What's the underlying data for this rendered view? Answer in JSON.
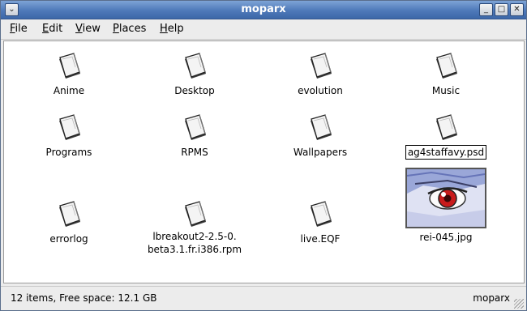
{
  "window": {
    "title": "moparx"
  },
  "menu": [
    {
      "label": "File",
      "u": "F",
      "rest": "ile"
    },
    {
      "label": "Edit",
      "u": "E",
      "rest": "dit"
    },
    {
      "label": "View",
      "u": "V",
      "rest": "iew"
    },
    {
      "label": "Places",
      "u": "P",
      "rest": "laces"
    },
    {
      "label": "Help",
      "u": "H",
      "rest": "elp"
    }
  ],
  "files": [
    {
      "name": "Anime",
      "icon": "document-icon"
    },
    {
      "name": "Desktop",
      "icon": "document-icon"
    },
    {
      "name": "evolution",
      "icon": "document-icon"
    },
    {
      "name": "Music",
      "icon": "document-icon"
    },
    {
      "name": "Programs",
      "icon": "document-icon"
    },
    {
      "name": "RPMS",
      "icon": "document-icon"
    },
    {
      "name": "Wallpapers",
      "icon": "document-icon"
    },
    {
      "name": "ag4staffavy.psd",
      "icon": "document-icon",
      "editing": true
    },
    {
      "name": "errorlog",
      "icon": "document-icon"
    },
    {
      "name": "lbreakout2-2.5-0.",
      "name2": "beta3.1.fr.i386.rpm",
      "icon": "document-icon"
    },
    {
      "name": "live.EQF",
      "icon": "document-icon"
    },
    {
      "name": "rei-045.jpg",
      "icon": "image-thumbnail"
    }
  ],
  "status": {
    "summary": "12 items, Free space: 12.1 GB",
    "location": "moparx"
  },
  "colors": {
    "titlebar": "#4e79b9",
    "content_bg": "#ffffff",
    "chrome_bg": "#ececec"
  }
}
